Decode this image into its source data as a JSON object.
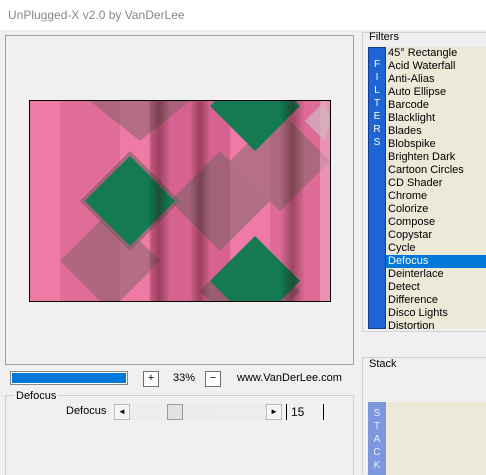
{
  "window": {
    "title": "UnPlugged-X v2.0 by VanDerLee"
  },
  "controls": {
    "progress": 1.0,
    "zoom_in_label": "+",
    "zoom_level": "33%",
    "zoom_out_label": "−",
    "website": "www.VanDerLee.com"
  },
  "effect": {
    "group_title": "Defocus",
    "slider_label": "Defocus",
    "slider_left_arrow": "◄",
    "slider_right_arrow": "►",
    "value": "15",
    "slider_fraction": 0.31
  },
  "filters": {
    "group_title": "Filters",
    "tab_letters": [
      "F",
      "I",
      "L",
      "T",
      "E",
      "R",
      "S"
    ],
    "items": [
      "45° Rectangle",
      "Acid Waterfall",
      "Anti-Alias",
      "Auto Ellipse",
      "Barcode",
      "Blacklight",
      "Blades",
      "Blobspike",
      "Brighten Dark",
      "Cartoon Circles",
      "CD Shader",
      "Chrome",
      "Colorize",
      "Compose",
      "Copystar",
      "Cycle",
      "Defocus",
      "Deinterlace",
      "Detect",
      "Difference",
      "Disco Lights",
      "Distortion"
    ],
    "selected": "Defocus"
  },
  "stack": {
    "group_title": "Stack",
    "tab_letters": [
      "S",
      "T",
      "A",
      "C",
      "K"
    ]
  },
  "colors": {
    "accent": "#0078d7",
    "filter_tab": "#1e64d2",
    "stack_tab": "#7b97de",
    "list_bg": "#ece9d8",
    "preview_pink": "#f07aa6",
    "preview_green": "#137a52"
  }
}
